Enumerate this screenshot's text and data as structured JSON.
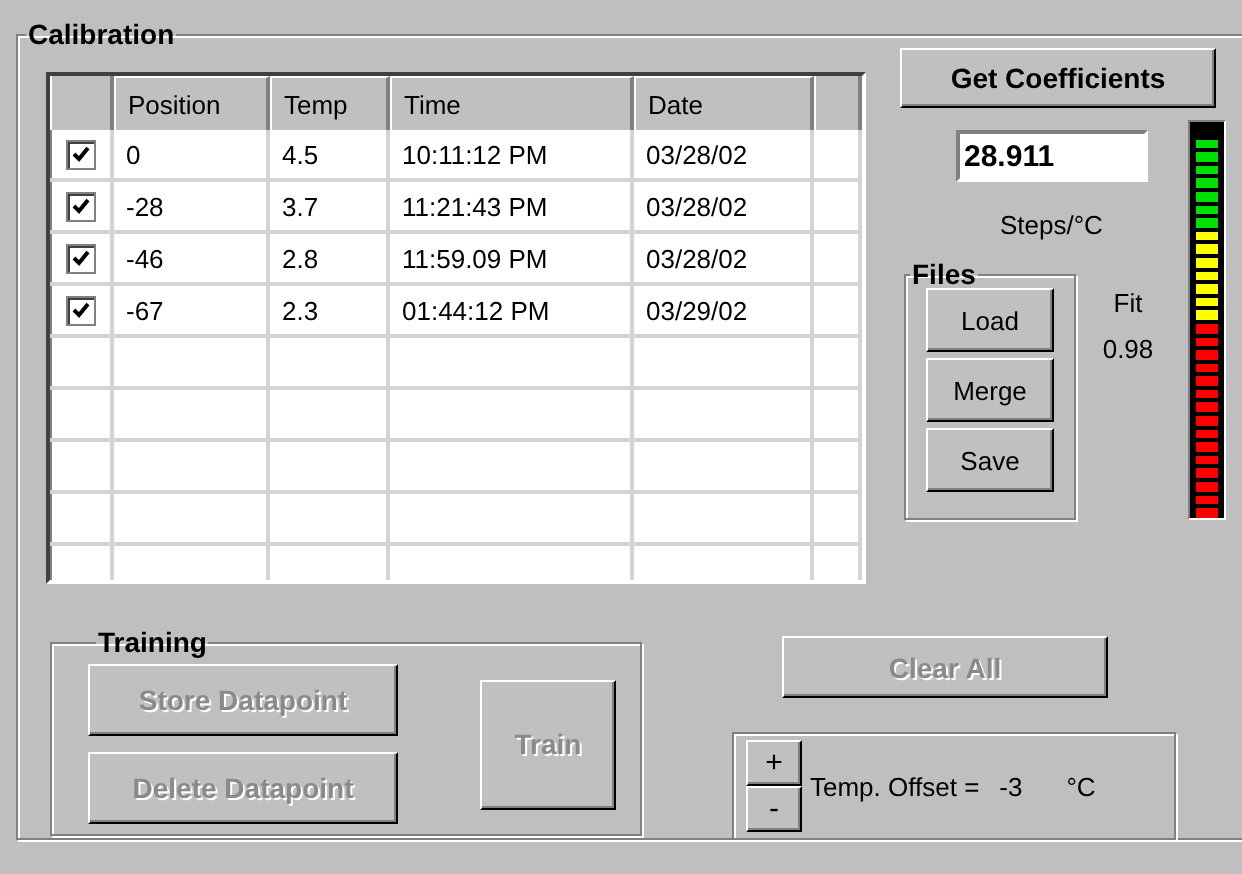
{
  "calibration": {
    "title": "Calibration",
    "table": {
      "columns": [
        "Position",
        "Temp",
        "Time",
        "Date"
      ],
      "rows": [
        {
          "checked": true,
          "cells": [
            "0",
            "4.5",
            "10:11:12 PM",
            "03/28/02"
          ]
        },
        {
          "checked": true,
          "cells": [
            "-28",
            "3.7",
            "11:21:43 PM",
            "03/28/02"
          ]
        },
        {
          "checked": true,
          "cells": [
            "-46",
            "2.8",
            "11:59.09 PM",
            "03/28/02"
          ]
        },
        {
          "checked": true,
          "cells": [
            "-67",
            "2.3",
            "01:44:12 PM",
            "03/29/02"
          ]
        }
      ]
    },
    "get_coefficients": {
      "label": "Get Coefficients",
      "disabled": false
    },
    "coefficient": {
      "value": "28.911"
    },
    "units": "Steps/°C",
    "files": {
      "title": "Files",
      "buttons": [
        {
          "label": "Load",
          "disabled": false
        },
        {
          "label": "Merge",
          "disabled": false
        },
        {
          "label": "Save",
          "disabled": false
        }
      ]
    },
    "fit": {
      "label": "Fit",
      "value": "0.98",
      "level": 0.97
    },
    "training": {
      "title": "Training",
      "store": {
        "label": "Store Datapoint",
        "disabled": true
      },
      "delete": {
        "label": "Delete Datapoint",
        "disabled": true
      },
      "train": {
        "label": "Train",
        "disabled": true
      }
    },
    "clear_all": {
      "label": "Clear All",
      "disabled": true
    },
    "offset": {
      "plus": "+",
      "minus": "-",
      "label": "Temp. Offset =",
      "value": "-3",
      "unit": "°C"
    }
  }
}
